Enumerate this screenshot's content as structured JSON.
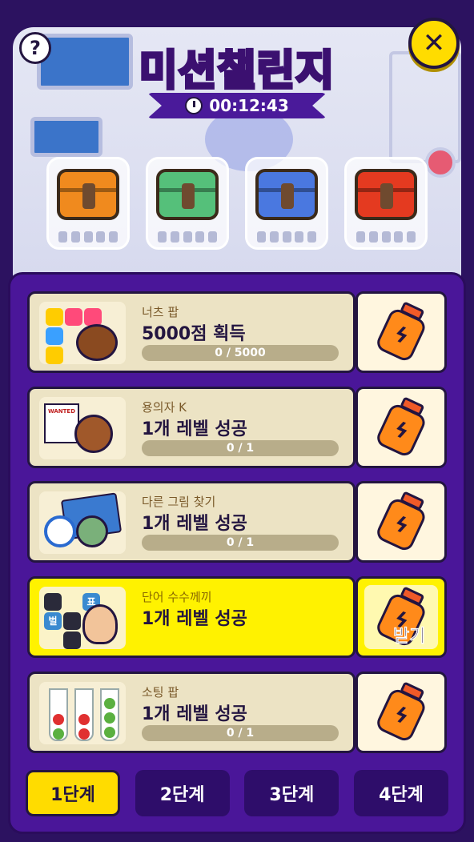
{
  "header": {
    "title": "미션챌린지",
    "timer": "00:12:43",
    "help_label": "?",
    "close_label": "✕"
  },
  "chests": [
    {
      "color": "#f08a1e"
    },
    {
      "color": "#55c07a"
    },
    {
      "color": "#4a78e0"
    },
    {
      "color": "#e43a20"
    }
  ],
  "missions": [
    {
      "game": "너츠 팝",
      "goal": "5000점 획득",
      "progress_text": "0 / 5000",
      "progress": 0,
      "active": false
    },
    {
      "game": "용의자 K",
      "goal": "1개 레벨 성공",
      "progress_text": "0 / 1",
      "progress": 0,
      "active": false
    },
    {
      "game": "다른 그림 찾기",
      "goal": "1개 레벨 성공",
      "progress_text": "0 / 1",
      "progress": 0,
      "active": false
    },
    {
      "game": "단어 수수께끼",
      "goal": "1개 레벨 성공",
      "progress_text": "",
      "progress": 1,
      "active": true,
      "claim_label": "받기"
    },
    {
      "game": "소팅 팝",
      "goal": "1개 레벨 성공",
      "progress_text": "0 / 1",
      "progress": 0,
      "active": false
    }
  ],
  "thumb_texts": {
    "wanted": "WANTED",
    "word_tile": "벌",
    "word_tile2": "표"
  },
  "stages": [
    {
      "label": "1단계",
      "active": true
    },
    {
      "label": "2단계",
      "active": false
    },
    {
      "label": "3단계",
      "active": false
    },
    {
      "label": "4단계",
      "active": false
    }
  ]
}
